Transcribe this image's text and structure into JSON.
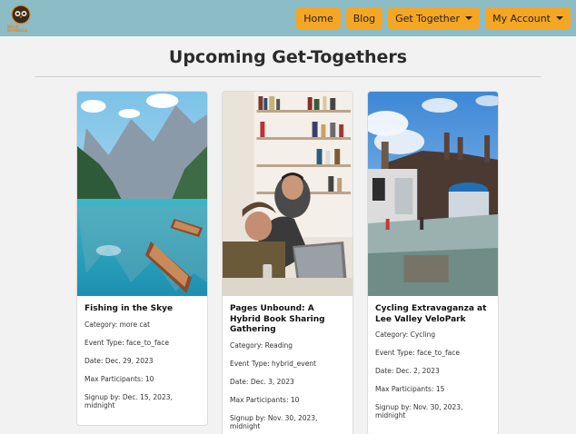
{
  "navbar": {
    "logo_text": "BOOK BONANZA",
    "home": "Home",
    "blog": "Blog",
    "get_together": "Get Together",
    "my_account": "My Account"
  },
  "page_title": "Upcoming Get-Togethers",
  "cards": [
    {
      "title": "Fishing in the Skye",
      "category": "Category: more cat",
      "event_type": "Event Type: face_to_face",
      "date": "Date: Dec. 29, 2023",
      "max_participants": "Max Participants: 10",
      "signup_by": "Signup by: Dec. 15, 2023, midnight"
    },
    {
      "title": "Pages Unbound: A Hybrid Book Sharing Gathering",
      "category": "Category: Reading",
      "event_type": "Event Type: hybrid_event",
      "date": "Date: Dec. 3, 2023",
      "max_participants": "Max Participants: 10",
      "signup_by": "Signup by: Nov. 30, 2023, midnight"
    },
    {
      "title": "Cycling Extravaganza at Lee Valley VeloPark",
      "category": "Category: Cycling",
      "event_type": "Event Type: face_to_face",
      "date": "Date: Dec. 2, 2023",
      "max_participants": "Max Participants: 15",
      "signup_by": "Signup by: Nov. 30, 2023, midnight"
    }
  ],
  "colors": {
    "navbar_bg": "#8cbcc6",
    "button_bg": "#f5a623"
  }
}
